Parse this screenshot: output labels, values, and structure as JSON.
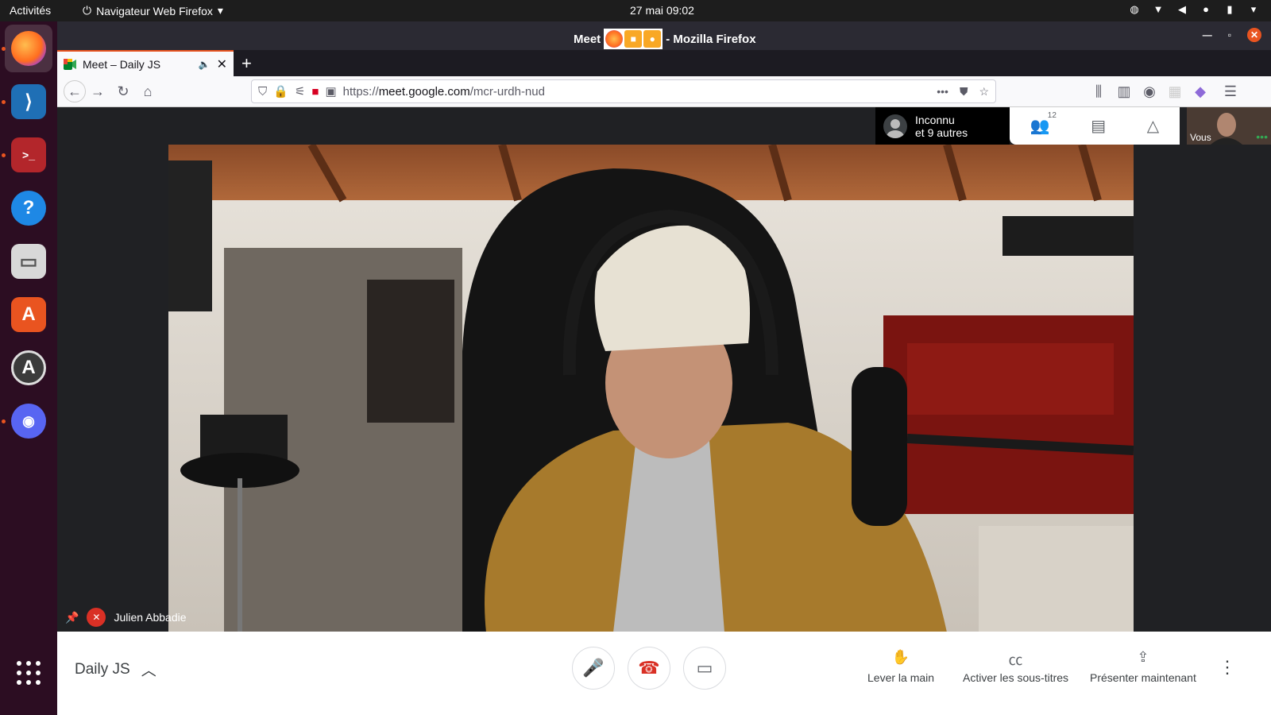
{
  "topbar": {
    "activities": "Activités",
    "app_menu": "Navigateur Web Firefox",
    "clock": "27 mai  09:02"
  },
  "window": {
    "title_prefix": "Meet",
    "title_suffix": "- Mozilla Firefox"
  },
  "tabs": [
    {
      "label": "Meet – Daily JS"
    }
  ],
  "urlbar": {
    "scheme": "https://",
    "domain": "meet.google.com",
    "path": "/mcr-urdh-nud"
  },
  "meet": {
    "participant_top": "Inconnu",
    "participant_sub": "et 9 autres",
    "participants_count": "12",
    "self_label": "Vous",
    "speaker_name": "Julien Abbadie",
    "meeting_name": "Daily JS",
    "actions": {
      "raise_hand": "Lever la main",
      "captions": "Activer les sous-titres",
      "present": "Présenter maintenant"
    }
  },
  "colors": {
    "ubuntu_orange": "#e95420",
    "dock_bg": "#2c0d22",
    "end_call_red": "#d93025"
  }
}
